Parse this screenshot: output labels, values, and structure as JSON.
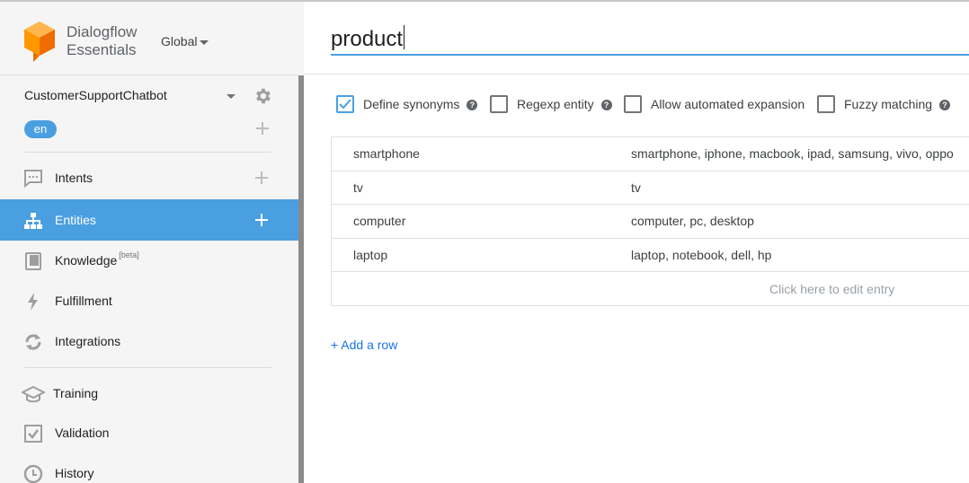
{
  "header": {
    "brand_line1": "Dialogflow",
    "brand_line2": "Essentials",
    "region": "Global"
  },
  "agent": {
    "name": "CustomerSupportChatbot",
    "language": "en"
  },
  "nav": [
    {
      "label": "Intents",
      "icon": "intents-icon",
      "has_add": true
    },
    {
      "label": "Entities",
      "icon": "entities-icon",
      "has_add": true,
      "active": true
    },
    {
      "label": "Knowledge",
      "badge": "[beta]",
      "icon": "knowledge-icon"
    },
    {
      "label": "Fulfillment",
      "icon": "fulfillment-icon"
    },
    {
      "label": "Integrations",
      "icon": "integrations-icon"
    },
    {
      "label": "Training",
      "icon": "training-icon"
    },
    {
      "label": "Validation",
      "icon": "validation-icon"
    },
    {
      "label": "History",
      "icon": "history-icon"
    }
  ],
  "entity": {
    "name": "product"
  },
  "options": [
    {
      "label": "Define synonyms",
      "checked": true,
      "help": true
    },
    {
      "label": "Regexp entity",
      "checked": false,
      "help": true
    },
    {
      "label": "Allow automated expansion",
      "checked": false,
      "help": false
    },
    {
      "label": "Fuzzy matching",
      "checked": false,
      "help": true
    }
  ],
  "entries": [
    {
      "value": "smartphone",
      "synonyms": "smartphone, iphone, macbook, ipad, samsung, vivo, oppo"
    },
    {
      "value": "tv",
      "synonyms": "tv"
    },
    {
      "value": "computer",
      "synonyms": "computer, pc, desktop"
    },
    {
      "value": "laptop",
      "synonyms": "laptop, notebook, dell, hp"
    }
  ],
  "edit_hint": "Click here to edit entry",
  "add_row_label": "+ Add a row",
  "colors": {
    "accent": "#4a9fe0",
    "logo_orange": "#f57c00",
    "link": "#1a73e8"
  }
}
